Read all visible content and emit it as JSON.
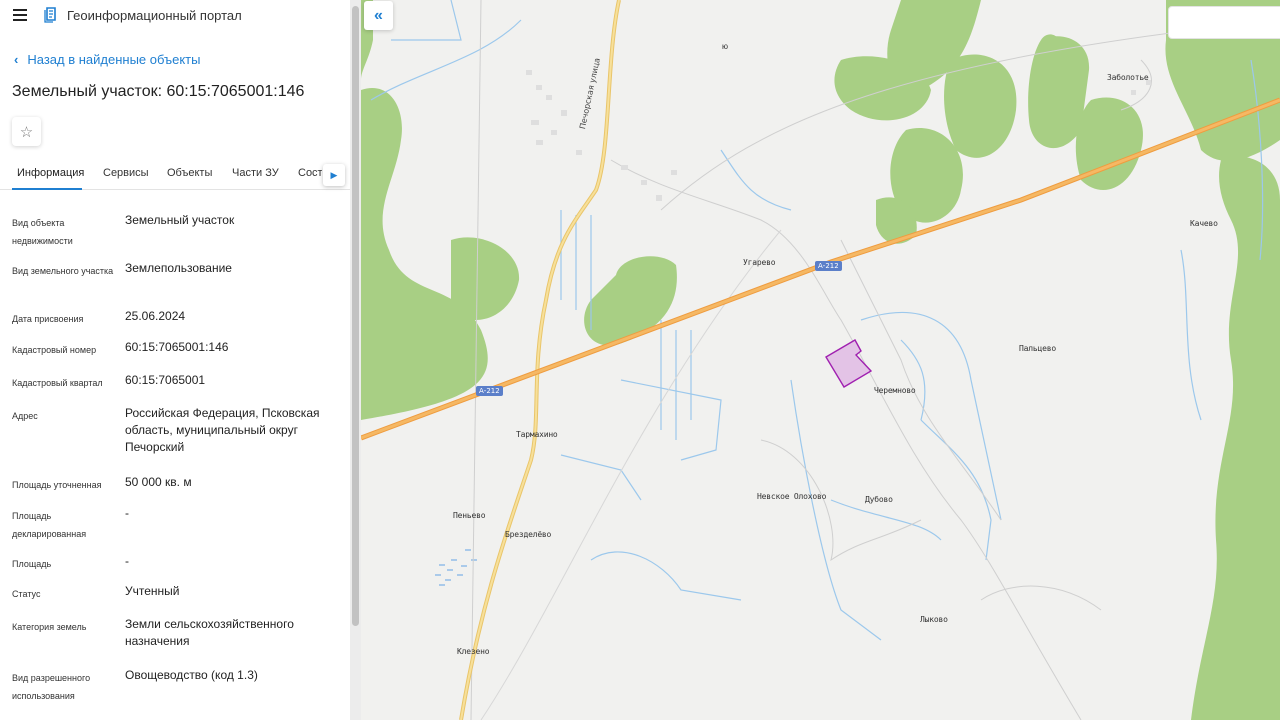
{
  "app": {
    "title": "Геоинформационный портал"
  },
  "nav": {
    "back_label": "Назад в найденные объекты"
  },
  "object": {
    "title": "Земельный участок: 60:15:7065001:146"
  },
  "tabs": [
    {
      "label": "Информация"
    },
    {
      "label": "Сервисы"
    },
    {
      "label": "Объекты"
    },
    {
      "label": "Части ЗУ"
    },
    {
      "label": "Состав"
    }
  ],
  "info_rows": [
    {
      "label": "Вид объекта недвижимости",
      "value": "Земельный участок"
    },
    {
      "label": "Вид земельного участка",
      "value": "Землепользование"
    },
    {
      "label": "Дата присвоения",
      "value": "25.06.2024"
    },
    {
      "label": "Кадастровый номер",
      "value": "60:15:7065001:146"
    },
    {
      "label": "Кадастровый квартал",
      "value": "60:15:7065001"
    },
    {
      "label": "Адрес",
      "value": "Российская Федерация, Псковская область, муниципальный округ Печорский"
    },
    {
      "label": "Площадь уточненная",
      "value": "50 000 кв. м"
    },
    {
      "label": "Площадь декларированная",
      "value": "-"
    },
    {
      "label": "Площадь",
      "value": "-"
    },
    {
      "label": "Статус",
      "value": "Учтенный"
    },
    {
      "label": "Категория земель",
      "value": "Земли сельскохозяйственного назначения"
    },
    {
      "label": "Вид разрешенного использования",
      "value": "Овощеводство (код 1.3)"
    }
  ],
  "map": {
    "places": [
      {
        "name": "Заболотье"
      },
      {
        "name": "Качево"
      },
      {
        "name": "Угарево"
      },
      {
        "name": "Пальцево"
      },
      {
        "name": "Черемново"
      },
      {
        "name": "Тармахино"
      },
      {
        "name": "Невское Олохово"
      },
      {
        "name": "Дубово"
      },
      {
        "name": "Пеньево"
      },
      {
        "name": "Брезделёво"
      },
      {
        "name": "Лыково"
      },
      {
        "name": "Клезено"
      }
    ],
    "road_label": "А-212",
    "street_label": "Печорская улица",
    "edge_label": "ю",
    "colors": {
      "forest": "#a8cf84",
      "highway": "#f2a94f",
      "secondary_road": "#f5d47a",
      "water": "#9cc8ec",
      "parcel_fill": "#e3c3e6",
      "parcel_stroke": "#a020b0",
      "accent": "#1f7fd1"
    }
  },
  "icons": {
    "menu": "hamburger-icon",
    "logo": "portal-logo-icon",
    "back": "chevron-left-icon",
    "favorite": "star-icon",
    "tabs_next": "triangle-right-icon",
    "collapse": "double-chevron-left-icon"
  },
  "glyphs": {
    "back": "‹",
    "star": "☆",
    "next": "▶",
    "collapse": "«"
  }
}
